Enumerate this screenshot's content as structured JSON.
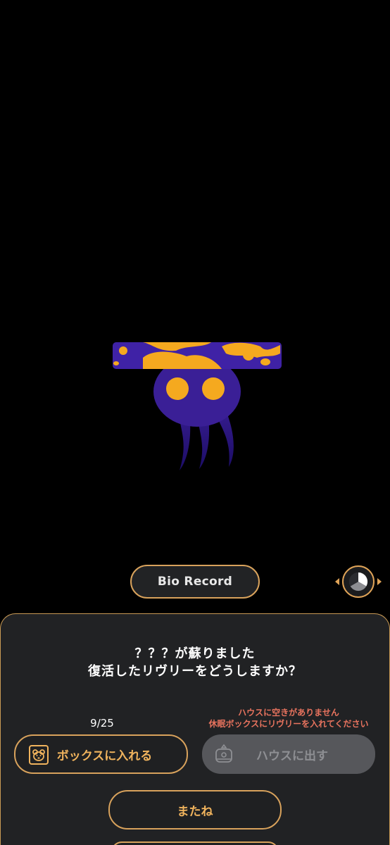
{
  "creature": {
    "name": "creature-illustration",
    "colors": {
      "body": "#3a1f96",
      "spots": "#f5a91f",
      "cap_top": "#3f22a6"
    }
  },
  "bio_record": {
    "label": "Bio Record"
  },
  "pager_icon": "pie-chart-icon",
  "dialog": {
    "line1": "？？？が蘇りました",
    "line2": "復活したリヴリーをどうしますか？",
    "count": "9/25",
    "warning_line1": "ハウスに空きがありません",
    "warning_line2": "休眠ボックスにリヴリーを入れてください",
    "box_button": {
      "label": "ボックスに入れる",
      "icon": "bear-box-icon"
    },
    "house_button": {
      "label": "ハウスに出す",
      "icon": "house-icon",
      "enabled": false
    },
    "bye_button": {
      "label": "またね"
    }
  },
  "colors": {
    "accent": "#d8a25c",
    "button_text": "#f0b35d",
    "warning": "#e8735e",
    "panel_bg": "#212224",
    "disabled_bg": "#56575b"
  }
}
